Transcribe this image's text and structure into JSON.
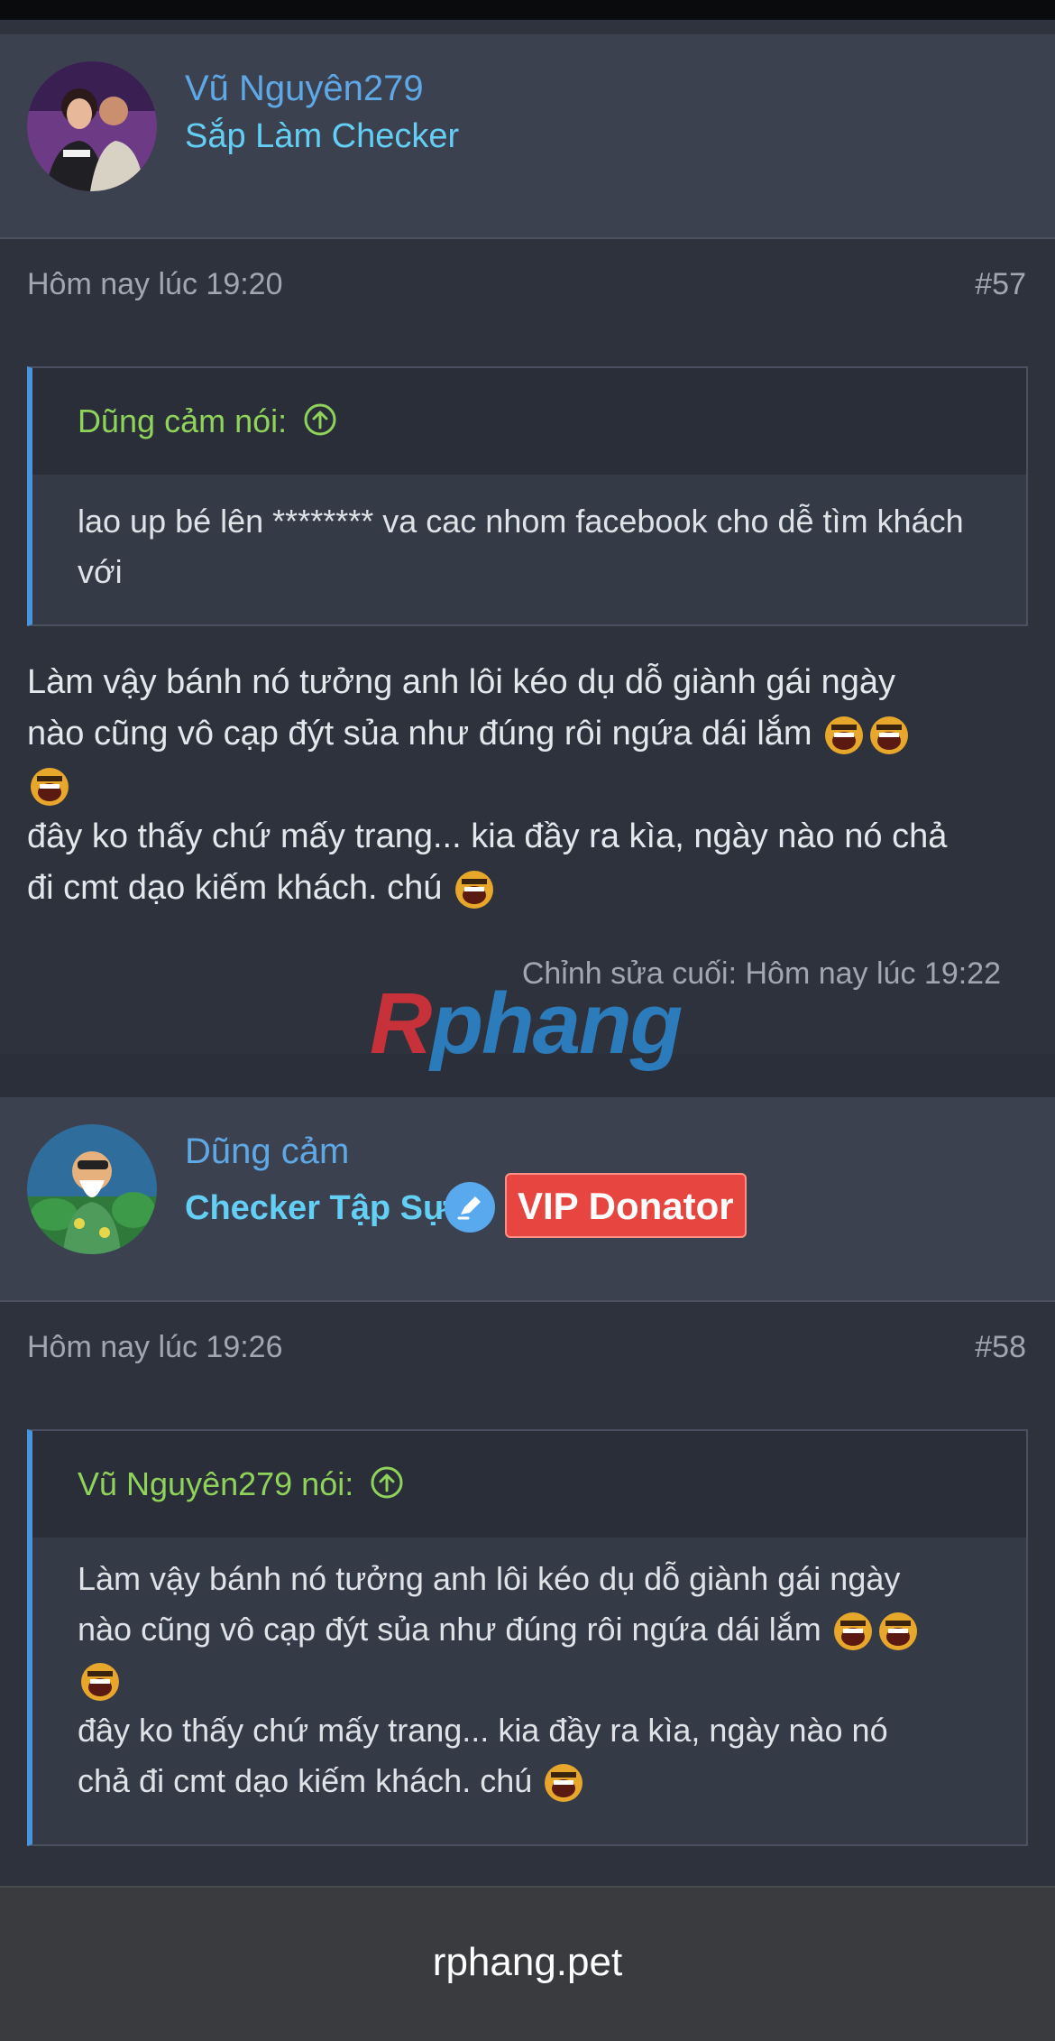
{
  "posts": [
    {
      "username": "Vũ Nguyên279",
      "user_title": "Sắp Làm Checker",
      "time": "Hôm nay lúc 19:20",
      "number": "#57",
      "quote_author": "Dũng cảm nói:",
      "quote_text": "lao up bé lên ******** va cac nhom facebook cho dễ tìm khách với",
      "body_line1": "Làm vậy bánh nó tưởng anh lôi kéo dụ dỗ giành gái ngày",
      "body_line2": "nào cũng vô cạp đýt sủa như đúng rôi ngứa dái lắm",
      "body_line3": "đây ko thấy chứ mấy trang... kia đầy ra kìa, ngày nào nó chả",
      "body_line4": "đi cmt dạo kiếm khách. chú",
      "edited": "Chỉnh sửa cuối: Hôm nay lúc 19:22"
    },
    {
      "username": "Dũng cảm",
      "user_title": "Checker Tập Sự",
      "badge": "VIP Donator",
      "time": "Hôm nay lúc 19:26",
      "number": "#58",
      "quote_author": "Vũ Nguyên279 nói:",
      "quote_line1": "Làm vậy bánh nó tưởng anh lôi kéo dụ dỗ giành gái ngày",
      "quote_line2": "nào cũng vô cạp đýt sủa như đúng rôi ngứa dái lắm",
      "quote_line3": "đây ko thấy chứ mấy trang... kia đầy ra kìa, ngày nào nó",
      "quote_line4": "chả đi cmt dạo kiếm khách. chú"
    }
  ],
  "watermark": {
    "r": "R",
    "rest": "phang"
  },
  "browser": {
    "url": "rphang.pet"
  },
  "colors": {
    "username": "#5fa8e6",
    "title": "#64cff4",
    "quote_author": "#8fd35a",
    "vip": "#e74640"
  }
}
